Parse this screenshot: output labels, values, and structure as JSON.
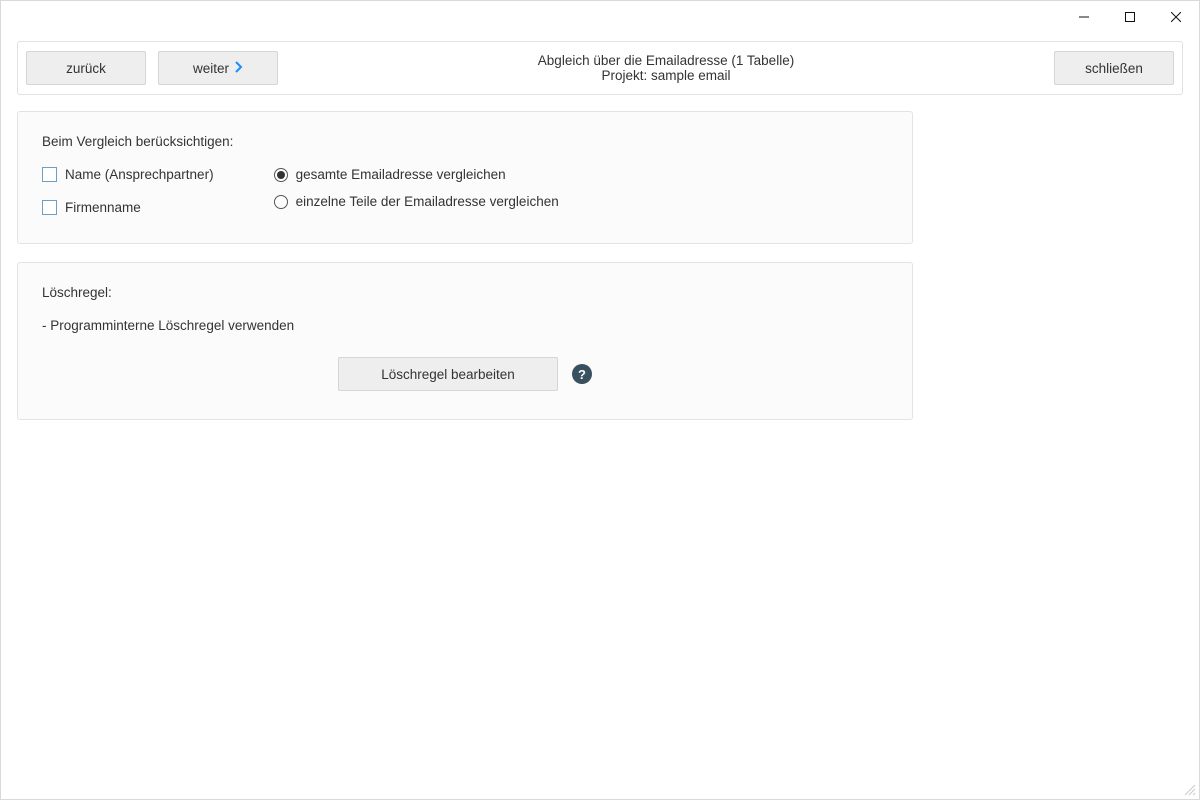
{
  "window_controls": {
    "minimize": "—",
    "maximize": "□",
    "close": "✕"
  },
  "toolbar": {
    "back_label": "zurück",
    "forward_label": "weiter",
    "close_label": "schließen"
  },
  "header": {
    "title": "Abgleich über die Emailadresse (1 Tabelle)",
    "project_label": "Projekt: sample email"
  },
  "compare_panel": {
    "heading": "Beim Vergleich berücksichtigen:",
    "check_name": "Name (Ansprechpartner)",
    "check_company": "Firmenname",
    "radio_full": "gesamte Emailadresse vergleichen",
    "radio_parts": "einzelne Teile der Emailadresse vergleichen"
  },
  "delete_panel": {
    "heading": "Löschregel:",
    "rule_line": "- Programminterne Löschregel verwenden",
    "edit_button": "Löschregel bearbeiten"
  },
  "icons": {
    "help": "?"
  }
}
